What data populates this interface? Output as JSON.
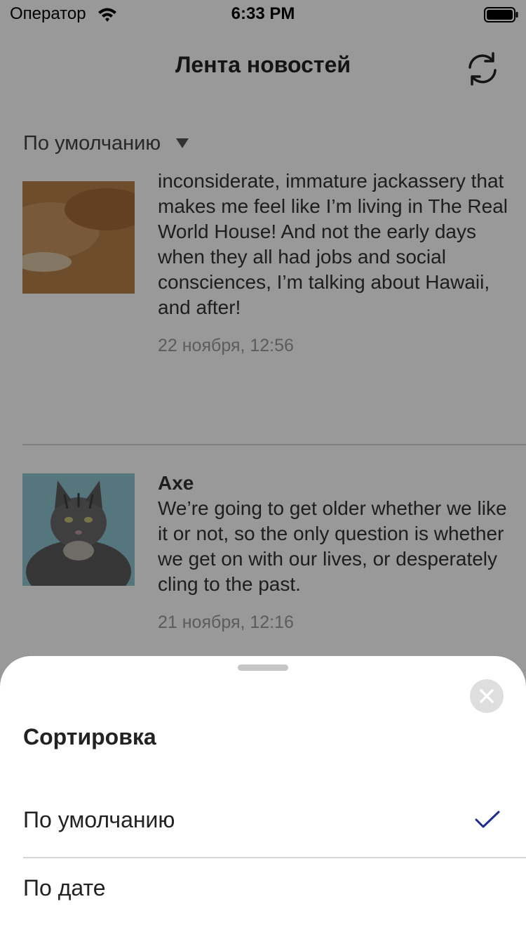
{
  "status_bar": {
    "carrier": "Оператор",
    "time": "6:33 PM"
  },
  "nav": {
    "title": "Лента новостей",
    "refresh_icon": "refresh-icon"
  },
  "sort_selector": {
    "selected": "По умолчанию",
    "icon": "caret-down-icon"
  },
  "posts": [
    {
      "author": "",
      "body": "peanut butter jar?! It’s this inconsiderate, immature jackassery that makes me feel like I’m living in The Real World House! And not the early days when they all had jobs and social consciences, I’m talking about Hawaii, and after!",
      "date": "22 ноября, 12:56",
      "image": "orange-cat-photo"
    },
    {
      "author": "Axe",
      "body": "We’re going to get older whether we like it or not, so the only question is whether we get on with our lives, or desperately cling to the past.",
      "date": "21 ноября, 12:16",
      "image": "tabby-cat-photo"
    }
  ],
  "sheet": {
    "title": "Сортировка",
    "close_icon": "close-icon",
    "options": [
      {
        "label": "По умолчанию",
        "selected": true
      },
      {
        "label": "По дате",
        "selected": false
      }
    ]
  },
  "colors": {
    "accent_check": "#1e2d8f",
    "overlay": "rgba(0,0,0,0.4)",
    "sheet_bg": "#ffffff"
  }
}
